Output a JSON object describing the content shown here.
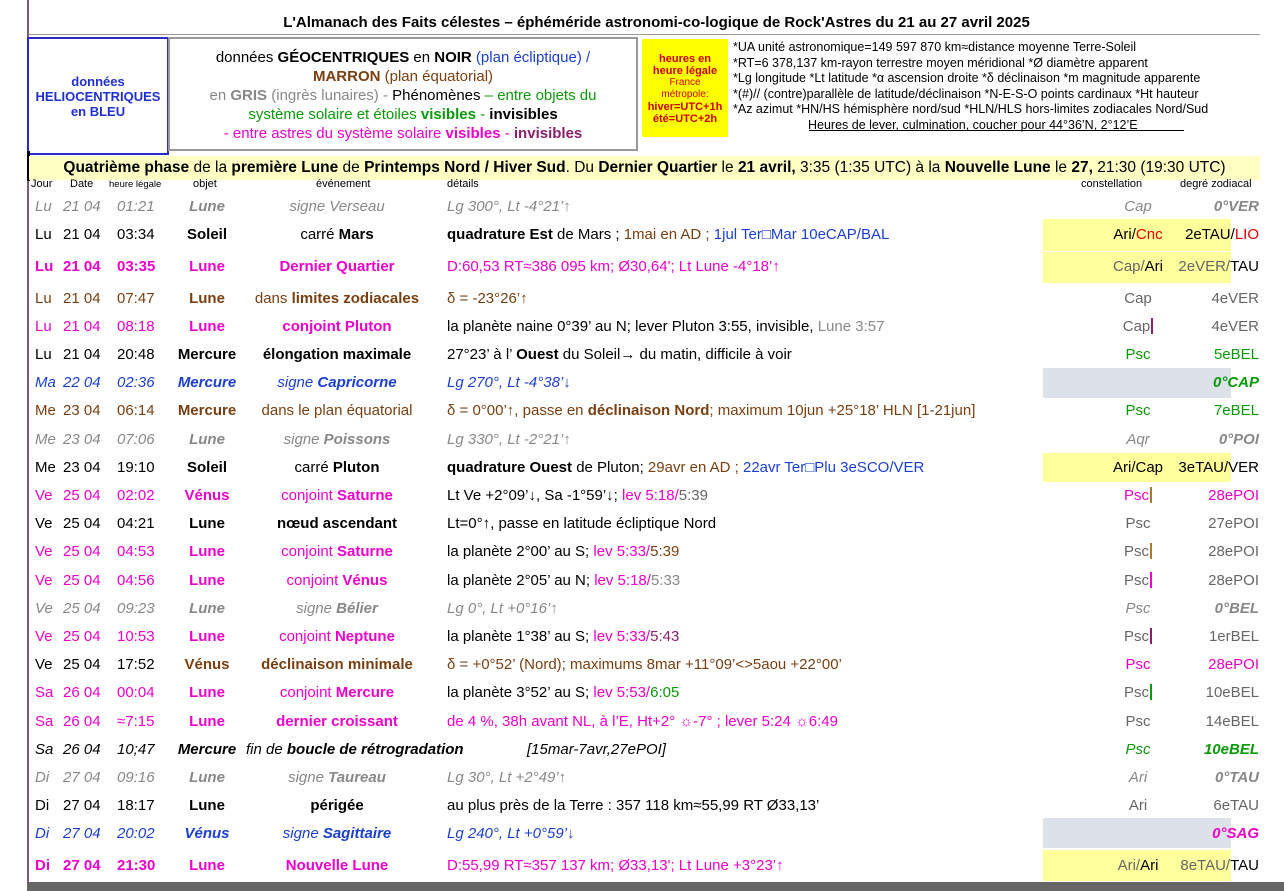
{
  "title": "L'Almanach des Faits célestes – éphéméride astronomi-co-logique de Rock'Astres du 21 au 27 avril 2025",
  "helio": [
    "données",
    "HELIOCENTRIQUES",
    "en BLEU"
  ],
  "geo": {
    "l1a": "données ",
    "l1b": "GÉOCENTRIQUES",
    "l1c": " en ",
    "l1d": "NOIR",
    "l1e": " (plan écliptique)  /",
    "l2a": "MARRON",
    "l2b": " (plan équatorial)",
    "l3a": "en ",
    "l3b": "GRIS",
    "l3c": " (ingrès lunaires)  -  ",
    "l3d": "Phénomènes",
    "l3e": " – entre objets du",
    "l4a": "système solaire et étoiles ",
    "l4b": "visibles",
    "l4c": " - ",
    "l4d": "invisibles",
    "l5a": "- entre astres du système solaire ",
    "l5b": "visibles",
    "l5c": " - ",
    "l5d": "invisibles"
  },
  "heures": {
    "l1": "heures en",
    "l2": "heure légale",
    "l3": "France",
    "l4": "métropole:",
    "l5": "hiver=UTC+1h",
    "l6": "été=UTC+2h"
  },
  "legend": [
    "*UA unité astronomique=149 597 870 km≈distance moyenne Terre-Soleil",
    "*RT=6 378,137 km-rayon terrestre moyen méridional    *Ø diamètre apparent",
    "*Lg longitude *Lt latitude  *α ascension droite *δ déclinaison  *m magnitude apparente",
    "*(#)// (contre)parallèle de latitude/déclinaison  *N-E-S-O points cardinaux  *Ht hauteur",
    "*Az azimut  *HN/HS hémisphère nord/sud  *HLN/HLS hors-limites zodiacales Nord/Sud",
    "Heures de lever, culmination, coucher pour 44°36’N, 2°12’E"
  ],
  "phase": {
    "a": "Quatrième phase",
    "b": " de la ",
    "c": "première Lune",
    "d": " de ",
    "e": "Printemps Nord / Hiver Sud",
    "f": ". Du ",
    "g": "Dernier Quartier",
    "h": " le ",
    "i": "21 avril,",
    "j": " 3:35 (1:35 UTC) à la ",
    "k": "Nouvelle Lune",
    "l": " le ",
    "m": "27,",
    "n": " 21:30 (19:30 UTC)"
  },
  "headers": {
    "jour": "Jour",
    "date": "Date",
    "heure": "heure légale",
    "objet": "objet",
    "evenement": "événement",
    "details": "détails",
    "constellation": "constellation",
    "degre": "degré zodiacal"
  },
  "rows": [
    {
      "jour": "Lu",
      "date": "21 04",
      "heure": "01:21",
      "obj": "Lune",
      "evt": "signe Verseau",
      "det": "Lg 300°, Lt -4°21’↑",
      "cst": "Cap",
      "deg": "0°VER"
    },
    {
      "jour": "Lu",
      "date": "21 04",
      "heure": "03:34",
      "obj": "Soleil",
      "evt_a": "carré ",
      "evt_b": "Mars",
      "det_a": "quadrature Est",
      "det_b": " de Mars ; ",
      "det_c": "1mai en AD ; ",
      "det_d": "1jul Ter□Mar 10eCAP/BAL",
      "cst_a": "Ari/",
      "cst_b": "Cnc",
      "deg_a": "2eTAU/",
      "deg_b": "LIO"
    },
    {
      "jour": "Lu",
      "date": "21 04",
      "heure": "03:35",
      "obj": "Lune",
      "evt": "Dernier Quartier",
      "det": "D:60,53 RT≈386 095 km; Ø30,64'; Lt Lune -4°18’↑",
      "cst_a": "Cap/",
      "cst_b": "Ari",
      "deg_a": "2eVER/",
      "deg_b": "TAU"
    },
    {
      "jour": "Lu",
      "date": "21 04",
      "heure": "07:47",
      "obj": "Lune",
      "evt_a": "dans ",
      "evt_b": "limites zodiacales",
      "det": "δ = -23°26’↑",
      "cst": "Cap",
      "deg": "4eVER"
    },
    {
      "jour": "Lu",
      "date": "21 04",
      "heure": "08:18",
      "obj": "Lune",
      "evt": "conjoint Pluton",
      "det_a": "la planète naine 0°39’ au N; lever Pluton 3:55, invisible, ",
      "det_b": "Lune 3:57",
      "cst": "Cap",
      "deg": "4eVER"
    },
    {
      "jour": "Lu",
      "date": "21 04",
      "heure": "20:48",
      "obj": "Mercure",
      "evt": "élongation maximale",
      "det_a": "27°23’ à l’ ",
      "det_b": "Ouest",
      "det_c": " du Soleil→ du matin, difficile à voir",
      "cst": "Psc",
      "deg": "5eBEL"
    },
    {
      "jour": "Ma",
      "date": "22 04",
      "heure": "02:36",
      "obj": "Mercure",
      "evt_a": "signe ",
      "evt_b": "Capricorne",
      "det": "Lg 270°, Lt -4°38’↓",
      "cst": "",
      "deg": "0°CAP"
    },
    {
      "jour": "Me",
      "date": "23 04",
      "heure": "06:14",
      "obj": "Mercure",
      "evt": "dans le plan équatorial",
      "det_a": "δ = 0°00’↑, passe en ",
      "det_b": "déclinaison Nord",
      "det_c": "; maximum 10jun +25°18’ HLN [1-21jun]",
      "cst": "Psc",
      "deg": "7eBEL"
    },
    {
      "jour": "Me",
      "date": "23 04",
      "heure": "07:06",
      "obj": "Lune",
      "evt_a": "signe ",
      "evt_b": "Poissons",
      "det": "Lg 330°, Lt -2°21’↑",
      "cst": "Aqr",
      "deg": "0°POI"
    },
    {
      "jour": "Me",
      "date": "23 04",
      "heure": "19:10",
      "obj": "Soleil",
      "evt_a": "carré ",
      "evt_b": "Pluton",
      "det_a": "quadrature Ouest",
      "det_b": " de Pluton; ",
      "det_c": "29avr en AD ; ",
      "det_d": "22avr Ter□Plu 3eSCO/VER",
      "cst_a": "Ari/",
      "cst_b": "Cap",
      "deg_a": "3eTAU/",
      "deg_b": "VER"
    },
    {
      "jour": "Ve",
      "date": "25 04",
      "heure": "02:02",
      "obj": "Vénus",
      "evt_a": "conjoint ",
      "evt_b": "Saturne",
      "det_a": "Lt Ve +2°09’↓, Sa -1°59’↓; ",
      "det_b": "lev 5:18/",
      "det_c": "5:39",
      "cst": "Psc",
      "deg": "28ePOI"
    },
    {
      "jour": "Ve",
      "date": "25 04",
      "heure": "04:21",
      "obj": "Lune",
      "evt": "nœud ascendant",
      "det": "Lt=0°↑, passe en latitude écliptique Nord",
      "cst": "Psc",
      "deg": "27ePOI"
    },
    {
      "jour": "Ve",
      "date": "25 04",
      "heure": "04:53",
      "obj": "Lune",
      "evt_a": "conjoint ",
      "evt_b": "Saturne",
      "det_a": "la planète 2°00’ au S; ",
      "det_b": "lev 5:33/",
      "det_c": "5:39",
      "cst": "Psc",
      "deg": "28ePOI"
    },
    {
      "jour": "Ve",
      "date": "25 04",
      "heure": "04:56",
      "obj": "Lune",
      "evt_a": "conjoint ",
      "evt_b": "Vénus",
      "det_a": "la planète 2°05’ au N; ",
      "det_b": "lev 5:18/",
      "det_c": "5:33",
      "cst": "Psc",
      "deg": "28ePOI"
    },
    {
      "jour": "Ve",
      "date": "25 04",
      "heure": "09:23",
      "obj": "Lune",
      "evt_a": "signe ",
      "evt_b": "Bélier",
      "det": "Lg 0°, Lt +0°16’↑",
      "cst": "Psc",
      "deg": "0°BEL"
    },
    {
      "jour": "Ve",
      "date": "25 04",
      "heure": "10:53",
      "obj": "Lune",
      "evt_a": "conjoint ",
      "evt_b": "Neptune",
      "det_a": "la planète 1°38’ au S; ",
      "det_b": "lev 5:33/",
      "det_c": "5:43",
      "cst": "Psc",
      "deg": "1erBEL"
    },
    {
      "jour": "Ve",
      "date": "25 04",
      "heure": "17:52",
      "obj": "Vénus",
      "evt": "déclinaison minimale",
      "det": "δ = +0°52’ (Nord); maximums 8mar +11°09’<>5aou +22°00’",
      "cst": "Psc",
      "deg": "28ePOI"
    },
    {
      "jour": "Sa",
      "date": "26 04",
      "heure": "00:04",
      "obj": "Lune",
      "evt_a": "conjoint ",
      "evt_b": "Mercure",
      "det_a": "la planète 3°52’ au S; ",
      "det_b": "lev 5:53/",
      "det_c": "6:05",
      "cst": "Psc",
      "deg": "10eBEL"
    },
    {
      "jour": "Sa",
      "date": "26 04",
      "heure": "≈7:15",
      "obj": "Lune",
      "evt": "dernier croissant",
      "det": "de 4 %, 38h avant NL, à l’E, Ht+2° ☼-7° ; lever 5:24 ☼6:49",
      "cst": "Psc",
      "deg": "14eBEL"
    },
    {
      "jour": "Sa",
      "date": "26 04",
      "heure": "10;47",
      "obj": "Mercure",
      "evt_a": "fin de ",
      "evt_b": "boucle de rétrogradation",
      "det": "[15mar-7avr,27ePOI]",
      "cst": "Psc",
      "deg": "10eBEL"
    },
    {
      "jour": "Di",
      "date": "27 04",
      "heure": "09:16",
      "obj": "Lune",
      "evt_a": "signe ",
      "evt_b": "Taureau",
      "det": "Lg 30°, Lt +2°49’↑",
      "cst": "Ari",
      "deg": "0°TAU"
    },
    {
      "jour": "Di",
      "date": "27 04",
      "heure": "18:17",
      "obj": "Lune",
      "evt": "périgée",
      "det": "au plus près de la Terre : 357 118 km≈55,99 RT Ø33,13’",
      "cst": "Ari",
      "deg": "6eTAU"
    },
    {
      "jour": "Di",
      "date": "27 04",
      "heure": "20:02",
      "obj": "Vénus",
      "evt_a": "signe ",
      "evt_b": "Sagittaire",
      "det": "Lg 240°, Lt +0°59’↓",
      "cst": "",
      "deg": "0°SAG"
    },
    {
      "jour": "Di",
      "date": "27 04",
      "heure": "21:30",
      "obj": "Lune",
      "evt": "Nouvelle Lune",
      "det": "D:55,99 RT≈357 137 km; Ø33,13'; Lt Lune +3°23’↑",
      "cst_a": "Ari/",
      "cst_b": "Ari",
      "deg_a": "8eTAU/",
      "deg_b": "TAU"
    }
  ]
}
